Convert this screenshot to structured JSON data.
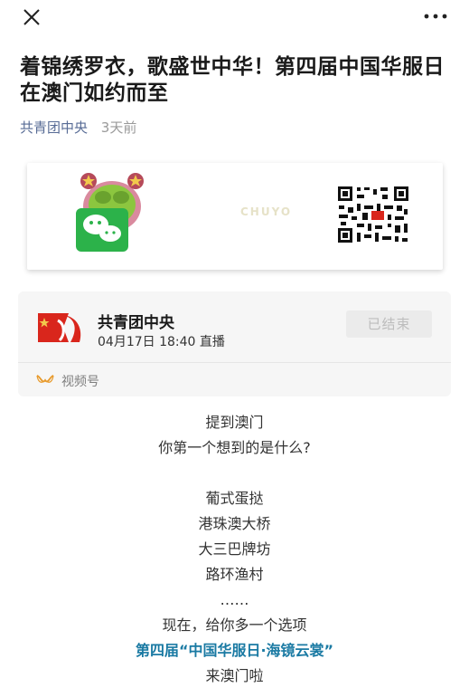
{
  "nav": {
    "close_icon": "close-icon",
    "more_icon": "more-icon"
  },
  "article": {
    "title": "着锦绣罗衣，歌盛世中华！第四届中国华服日在澳门如约而至",
    "author": "共青团中央",
    "time": "3天前"
  },
  "qr_card": {
    "logo_icon": "wechat-mascot-logo",
    "faint_mark": "CHUYO",
    "qr_icon": "qr-code"
  },
  "live": {
    "account_name": "共青团中央",
    "datetime": "04月17日 18:40 直播",
    "status": "已结束",
    "channel_icon": "channels-icon",
    "channel_label": "视频号",
    "accent": "#d9261c"
  },
  "content_lines": [
    "提到澳门",
    "你第一个想到的是什么?",
    "葡式蛋挞",
    "港珠澳大桥",
    "大三巴牌坊",
    "路环渔村",
    "……",
    "现在，给你多一个选项",
    "第四届“中国华服日·海镜云裳”",
    "来澳门啦"
  ],
  "colors": {
    "link": "#576b95",
    "highlight": "#1a7aa3",
    "text": "#333333"
  }
}
